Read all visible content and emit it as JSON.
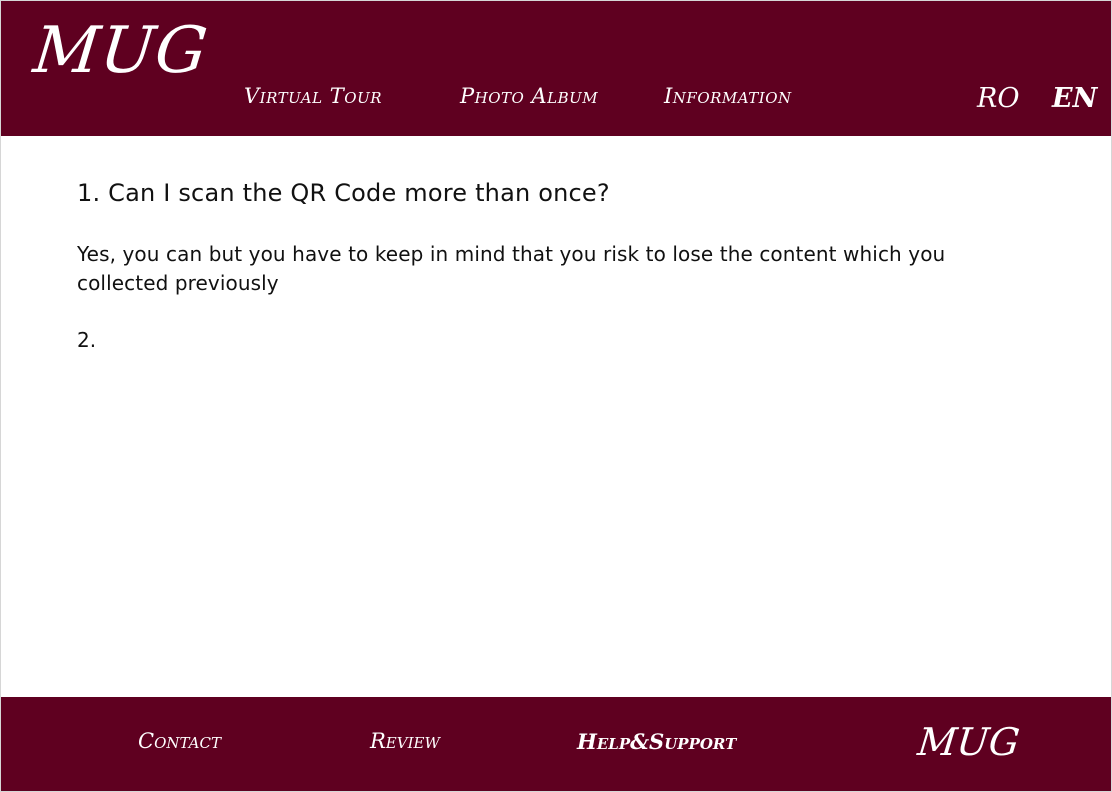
{
  "colors": {
    "brand": "#5f0020",
    "text_light": "#ffffff",
    "text_dark": "#111111",
    "background": "#ffffff"
  },
  "header": {
    "logo": "MUG",
    "nav": {
      "virtual_tour": "Virtual Tour",
      "photo_album": "Photo Album",
      "information": "Information"
    },
    "languages": {
      "ro": "RO",
      "en": "EN",
      "active": "EN"
    }
  },
  "main": {
    "faq": {
      "q1": "1. Can I scan the QR Code more than once?",
      "a1": "Yes, you can but you have to keep in mind that you risk to lose the content which you collected previously",
      "q2": "2."
    }
  },
  "footer": {
    "contact": "Contact",
    "review": "Review",
    "help_support": "Help&Support",
    "logo": "MUG"
  }
}
